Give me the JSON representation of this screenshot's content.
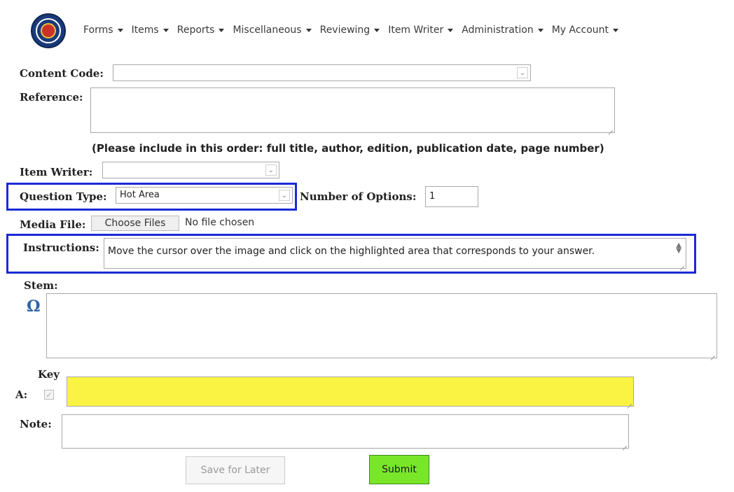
{
  "nav": {
    "menu": [
      {
        "label": "Forms"
      },
      {
        "label": "Items"
      },
      {
        "label": "Reports"
      },
      {
        "label": "Miscellaneous"
      },
      {
        "label": "Reviewing"
      },
      {
        "label": "Item Writer"
      },
      {
        "label": "Administration"
      },
      {
        "label": "My Account"
      }
    ]
  },
  "form": {
    "content_code_label": "Content Code:",
    "content_code_value": "",
    "reference_label": "Reference:",
    "reference_value": "",
    "reference_hint": "(Please include in this order: full title, author, edition, publication date, page number)",
    "item_writer_label": "Item Writer:",
    "item_writer_value": "",
    "question_type_label": "Question Type:",
    "question_type_value": "Hot Area",
    "number_of_options_label": "Number of Options:",
    "number_of_options_value": "1",
    "media_file_label": "Media File:",
    "choose_files_label": "Choose Files",
    "no_file_text": "No file chosen",
    "instructions_label": "Instructions:",
    "instructions_value": "Move the cursor over the image and click on the highlighted area that corresponds to your answer.",
    "stem_label": "Stem:",
    "omega_symbol": "Ω",
    "key_label": "Key",
    "option_a_label": "A:",
    "note_label": "Note:",
    "save_later_label": "Save for Later",
    "submit_label": "Submit"
  },
  "colors": {
    "highlight_box": "#1a2bd6",
    "key_field": "#fbf343",
    "submit_button": "#7ae62a"
  }
}
